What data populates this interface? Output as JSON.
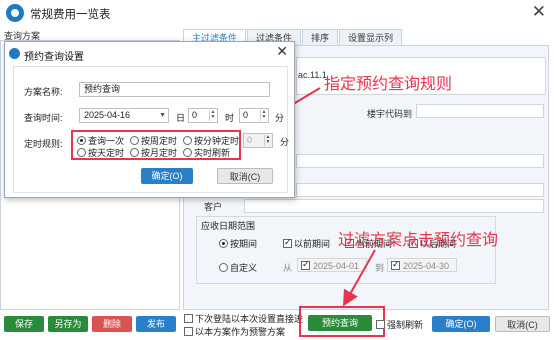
{
  "window": {
    "title": "常规费用一览表"
  },
  "scheme": {
    "title": "查询方案"
  },
  "tabs": [
    "主过滤条件",
    "过滤条件",
    "排序",
    "设置显示列"
  ],
  "panel": {
    "ghost_text": "ac.11.1",
    "building_code_label": "楼宇代码到",
    "customer_label": "客户"
  },
  "due": {
    "group_title": "应收日期范围",
    "by_period": "按期间",
    "prev_period": "以前期间",
    "curr_period": "当前期间",
    "later_period": "以后期间",
    "custom": "自定义",
    "from": "从",
    "to": "到",
    "from_date": "2025-04-01",
    "to_date": "2025-04-30"
  },
  "bottom": {
    "save": "保存",
    "save_as": "另存为",
    "delete": "删除",
    "publish": "发布",
    "next_login": "下次登陆以本次设置直接进",
    "as_default": "以本方案作为预警方案",
    "schedule_query": "预约查询",
    "force_refresh": "强制刷新",
    "ok": "确定(O)",
    "cancel": "取消(C)"
  },
  "dialog": {
    "title": "预约查询设置",
    "scheme_name_label": "方案名称:",
    "scheme_name_value": "预约查询",
    "query_time_label": "查询时间:",
    "date_value": "2025-04-16",
    "day_label": "日",
    "hour_label": "时",
    "minute_label": "分",
    "day_value": "0",
    "hour_value": "0",
    "minute_value": "0",
    "rule_label": "定时规则:",
    "rule_minute_value": "0",
    "rule_minute_unit": "分",
    "options": [
      "查询一次",
      "按周定时",
      "按分钟定时",
      "按天定时",
      "按月定时",
      "实时刷新"
    ],
    "ok": "确定(O)",
    "cancel": "取消(C)"
  },
  "annotations": {
    "top": "指定预约查询规则",
    "bottom": "过滤方案点击预约查询"
  },
  "colors": {
    "accent": "#e8344e",
    "primary": "#2a7fc9",
    "green": "#2a8c3a"
  }
}
